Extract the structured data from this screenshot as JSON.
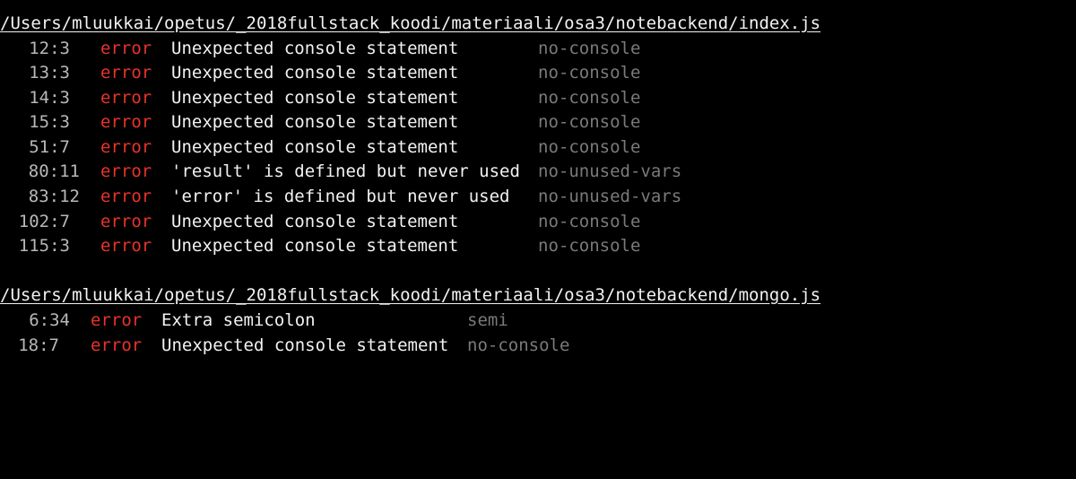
{
  "colors": {
    "background": "#000000",
    "text": "#f2f2f2",
    "location": "#b8b8b8",
    "error": "#e8332a",
    "rule": "#7a7a7a"
  },
  "files": [
    {
      "path": "/Users/mluukkai/opetus/_2018fullstack_koodi/materiaali/osa3/notebackend/index.js",
      "messages": [
        {
          "location": "12:3",
          "severity": "error",
          "message": "Unexpected console statement",
          "rule": "no-console"
        },
        {
          "location": "13:3",
          "severity": "error",
          "message": "Unexpected console statement",
          "rule": "no-console"
        },
        {
          "location": "14:3",
          "severity": "error",
          "message": "Unexpected console statement",
          "rule": "no-console"
        },
        {
          "location": "15:3",
          "severity": "error",
          "message": "Unexpected console statement",
          "rule": "no-console"
        },
        {
          "location": "51:7",
          "severity": "error",
          "message": "Unexpected console statement",
          "rule": "no-console"
        },
        {
          "location": "80:11",
          "severity": "error",
          "message": "'result' is defined but never used",
          "rule": "no-unused-vars"
        },
        {
          "location": "83:12",
          "severity": "error",
          "message": "'error' is defined but never used",
          "rule": "no-unused-vars"
        },
        {
          "location": "102:7",
          "severity": "error",
          "message": "Unexpected console statement",
          "rule": "no-console"
        },
        {
          "location": "115:3",
          "severity": "error",
          "message": "Unexpected console statement",
          "rule": "no-console"
        }
      ]
    },
    {
      "path": "/Users/mluukkai/opetus/_2018fullstack_koodi/materiaali/osa3/notebackend/mongo.js",
      "messages": [
        {
          "location": "6:34",
          "severity": "error",
          "message": "Extra semicolon",
          "rule": "semi"
        },
        {
          "location": "18:7",
          "severity": "error",
          "message": "Unexpected console statement",
          "rule": "no-console"
        }
      ]
    }
  ]
}
